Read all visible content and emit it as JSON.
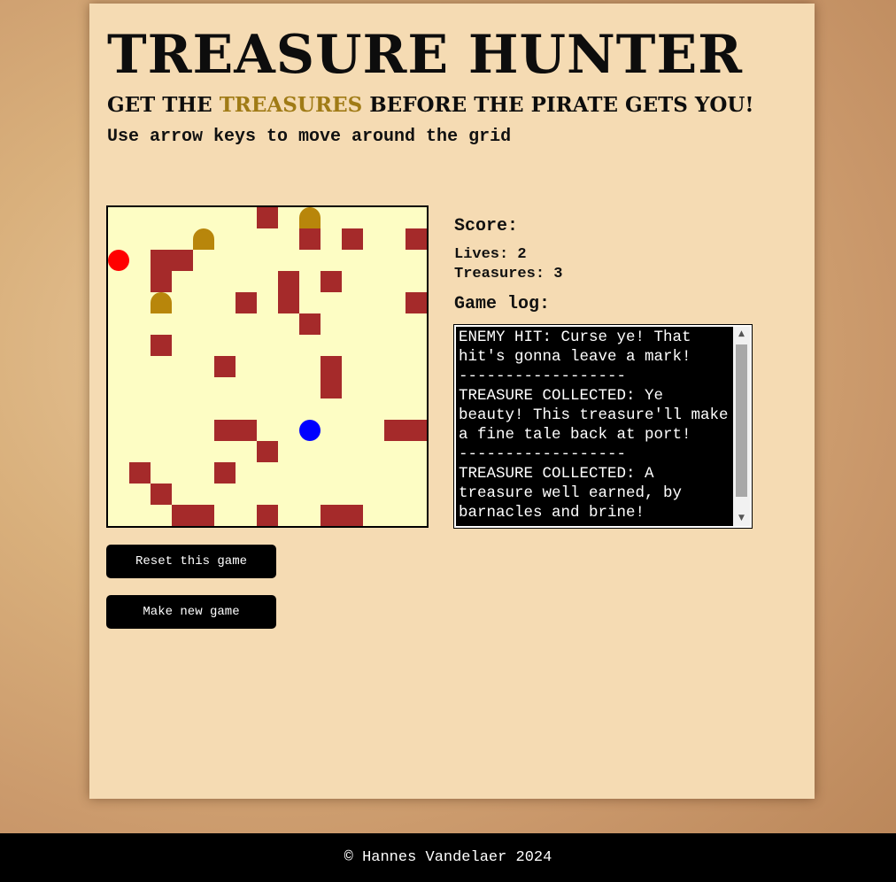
{
  "header": {
    "title": "TREASURE HUNTER",
    "subtitle_before": "GET THE ",
    "subtitle_highlight": "TREASURES",
    "subtitle_after": " BEFORE THE PIRATE GETS YOU!",
    "instructions": "Use arrow keys to move around the grid"
  },
  "stats": {
    "score_label": "Score:",
    "lives": "Lives: 2",
    "treasures": "Treasures: 3",
    "log_label": "Game log:"
  },
  "game_log": [
    "ENEMY HIT: Curse ye! That hit's gonna leave a mark!",
    "------------------",
    "TREASURE COLLECTED: Ye beauty! This treasure'll make a fine tale back at port!",
    "------------------",
    "TREASURE COLLECTED: A treasure well earned, by barnacles and brine!"
  ],
  "buttons": {
    "reset": "Reset this game",
    "new_game": "Make new game"
  },
  "footer": {
    "copyright": "© Hannes Vandelaer 2024"
  },
  "board": {
    "cols": 15,
    "rows": 15,
    "colors": {
      "floor": "#fdfdc4",
      "wall": "#a52a2a",
      "treasure": "#b8860b",
      "player": "#0000ff",
      "enemy": "#ff0000"
    },
    "walls": [
      [
        7,
        0
      ],
      [
        9,
        1
      ],
      [
        11,
        1
      ],
      [
        14,
        1
      ],
      [
        2,
        2
      ],
      [
        3,
        2
      ],
      [
        2,
        3
      ],
      [
        8,
        3
      ],
      [
        10,
        3
      ],
      [
        8,
        4
      ],
      [
        6,
        4
      ],
      [
        14,
        4
      ],
      [
        9,
        5
      ],
      [
        2,
        6
      ],
      [
        5,
        7
      ],
      [
        10,
        7
      ],
      [
        10,
        8
      ],
      [
        5,
        10
      ],
      [
        6,
        10
      ],
      [
        13,
        10
      ],
      [
        14,
        10
      ],
      [
        7,
        11
      ],
      [
        1,
        12
      ],
      [
        5,
        12
      ],
      [
        2,
        13
      ],
      [
        3,
        14
      ],
      [
        4,
        14
      ],
      [
        7,
        14
      ],
      [
        10,
        14
      ],
      [
        11,
        14
      ]
    ],
    "treasures": [
      [
        9,
        0
      ],
      [
        4,
        1
      ],
      [
        2,
        4
      ]
    ],
    "player": [
      9,
      10
    ],
    "enemy": [
      0,
      2
    ]
  }
}
